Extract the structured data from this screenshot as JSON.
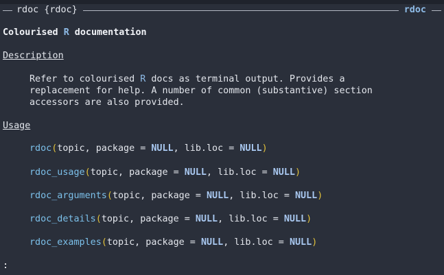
{
  "header": {
    "left_label": "rdoc {rdoc}",
    "right_label": "rdoc"
  },
  "title": {
    "prefix": "Colourised ",
    "highlight": "R",
    "suffix": " documentation"
  },
  "description": {
    "heading": "Description",
    "line1_prefix": "Refer to colourised ",
    "line1_highlight": "R",
    "line1_suffix": " docs as terminal output. Provides a",
    "line2": "replacement for help. A number of common (substantive) section",
    "line3": "accessors are also provided."
  },
  "usage": {
    "heading": "Usage",
    "items": [
      {
        "fn": "rdoc",
        "open": "(",
        "args1": "topic, package = ",
        "null1": "NULL",
        "args2": ", lib.loc = ",
        "null2": "NULL",
        "close": ")"
      },
      {
        "fn": "rdoc_usage",
        "open": "(",
        "args1": "topic, package = ",
        "null1": "NULL",
        "args2": ", lib.loc = ",
        "null2": "NULL",
        "close": ")"
      },
      {
        "fn": "rdoc_arguments",
        "open": "(",
        "args1": "topic, package = ",
        "null1": "NULL",
        "args2": ", lib.loc = ",
        "null2": "NULL",
        "close": ")"
      },
      {
        "fn": "rdoc_details",
        "open": "(",
        "args1": "topic, package = ",
        "null1": "NULL",
        "args2": ", lib.loc = ",
        "null2": "NULL",
        "close": ")"
      },
      {
        "fn": "rdoc_examples",
        "open": "(",
        "args1": "topic, package = ",
        "null1": "NULL",
        "args2": ", lib.loc = ",
        "null2": "NULL",
        "close": ")"
      }
    ]
  },
  "pager_prompt": ":",
  "colors": {
    "background": "#2a2f3a",
    "text": "#e3e6ec",
    "highlight": "#8fbce8",
    "function": "#7cc0ea",
    "paren": "#e0c03a",
    "keyword": "#a9c8f0"
  }
}
